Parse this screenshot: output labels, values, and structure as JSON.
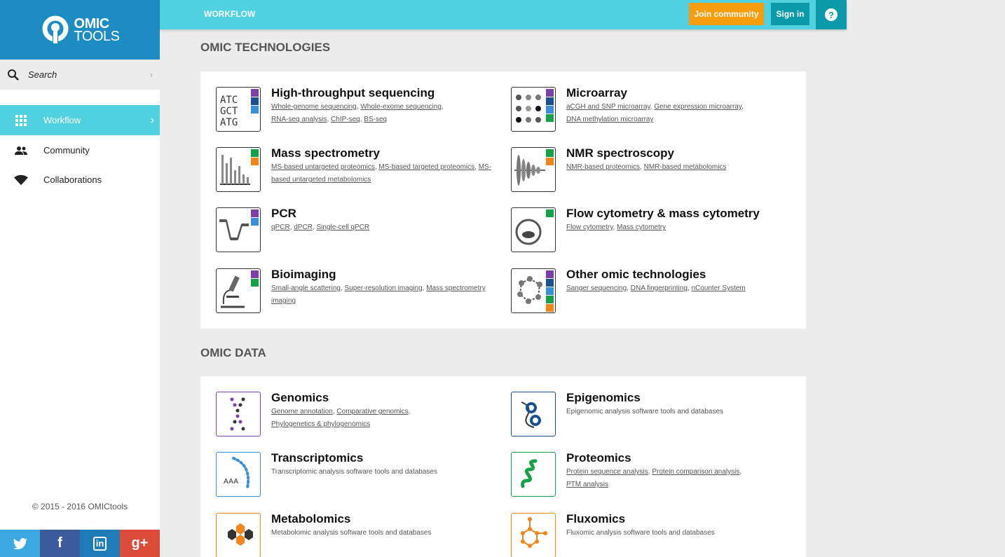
{
  "logo": {
    "line1": "OMIC",
    "line2": "TOOLS"
  },
  "search": {
    "label": "Search"
  },
  "nav": [
    {
      "label": "Workflow",
      "icon": "grid-icon"
    },
    {
      "label": "Community",
      "icon": "people-icon"
    },
    {
      "label": "Collaborations",
      "icon": "wifi-icon"
    }
  ],
  "copyright": "© 2015 - 2016 OMICtools",
  "social": {
    "twitter": "t",
    "facebook": "f",
    "linkedin": "in",
    "googleplus": "g+"
  },
  "topbar": {
    "brand": "WORKFLOW",
    "join": "Join community",
    "signin": "Sign in",
    "help": "?"
  },
  "colors": {
    "brand_blue": "#1c8cc2",
    "accent_cyan": "#4fd1e0",
    "teal": "#0a9aaa",
    "orange": "#f59d0c"
  },
  "technologies": {
    "title": "OMIC TECHNOLOGIES",
    "items": [
      {
        "title": "High-throughput sequencing",
        "links": [
          "Whole-genome sequencing",
          "Whole-exome sequencing",
          "RNA-seq analysis",
          "ChIP-seq",
          "BS-seq"
        ]
      },
      {
        "title": "Microarray",
        "links": [
          "aCGH and SNP microarray",
          "Gene expression microarray",
          "DNA methylation microarray"
        ]
      },
      {
        "title": "Mass spectrometry",
        "links": [
          "MS-based untargeted proteomics",
          "MS-based targeted proteomics",
          "MS-based untargeted metabolomics"
        ]
      },
      {
        "title": "NMR spectroscopy",
        "links": [
          "NMR-based proteomics",
          "NMR-based metabolomics"
        ]
      },
      {
        "title": "PCR",
        "links": [
          "qPCR",
          "dPCR",
          "Single-cell qPCR"
        ]
      },
      {
        "title": "Flow cytometry & mass cytometry",
        "links": [
          "Flow cytometry",
          "Mass cytometry"
        ]
      },
      {
        "title": "Bioimaging",
        "links": [
          "Small-angle scattering",
          "Super-resolution imaging",
          "Mass spectrometry imaging"
        ]
      },
      {
        "title": "Other omic technologies",
        "links": [
          "Sanger sequencing",
          "DNA fingerprinting",
          "nCounter System"
        ]
      }
    ]
  },
  "data": {
    "title": "OMIC DATA",
    "items": [
      {
        "title": "Genomics",
        "links": [
          "Genome annotation",
          "Comparative genomics",
          "Phylogenetics & phylogenomics"
        ]
      },
      {
        "title": "Epigenomics",
        "text": "Epigenomic analysis software tools and databases"
      },
      {
        "title": "Transcriptomics",
        "text": "Transcriptomic analysis software tools and databases"
      },
      {
        "title": "Proteomics",
        "links": [
          "Protein sequence analysis",
          "Protein comparison analysis",
          "PTM analysis"
        ]
      },
      {
        "title": "Metabolomics",
        "text": "Metabolomic analysis software tools and databases"
      },
      {
        "title": "Fluxomics",
        "text": "Fluxomic analysis software tools and databases"
      }
    ]
  },
  "icon_text": {
    "seq": [
      "ATC",
      "GCT",
      "ATG"
    ],
    "aaa": "AAA"
  }
}
